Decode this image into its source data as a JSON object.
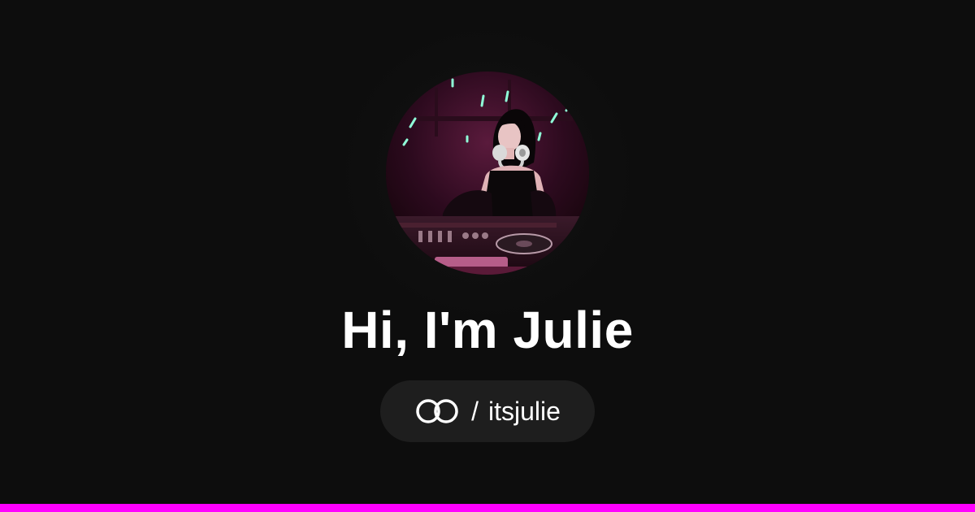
{
  "profile": {
    "greeting": "Hi, I'm Julie",
    "separator": "/",
    "username": "itsjulie",
    "avatar_alt": "Julie DJing at a nightclub with headphones around her neck",
    "logo_icon": "interlocking-rings-icon"
  },
  "colors": {
    "background": "#0d0d0d",
    "pill_background": "#1e1e1e",
    "text": "#ffffff",
    "accent": "#ff00ff"
  }
}
